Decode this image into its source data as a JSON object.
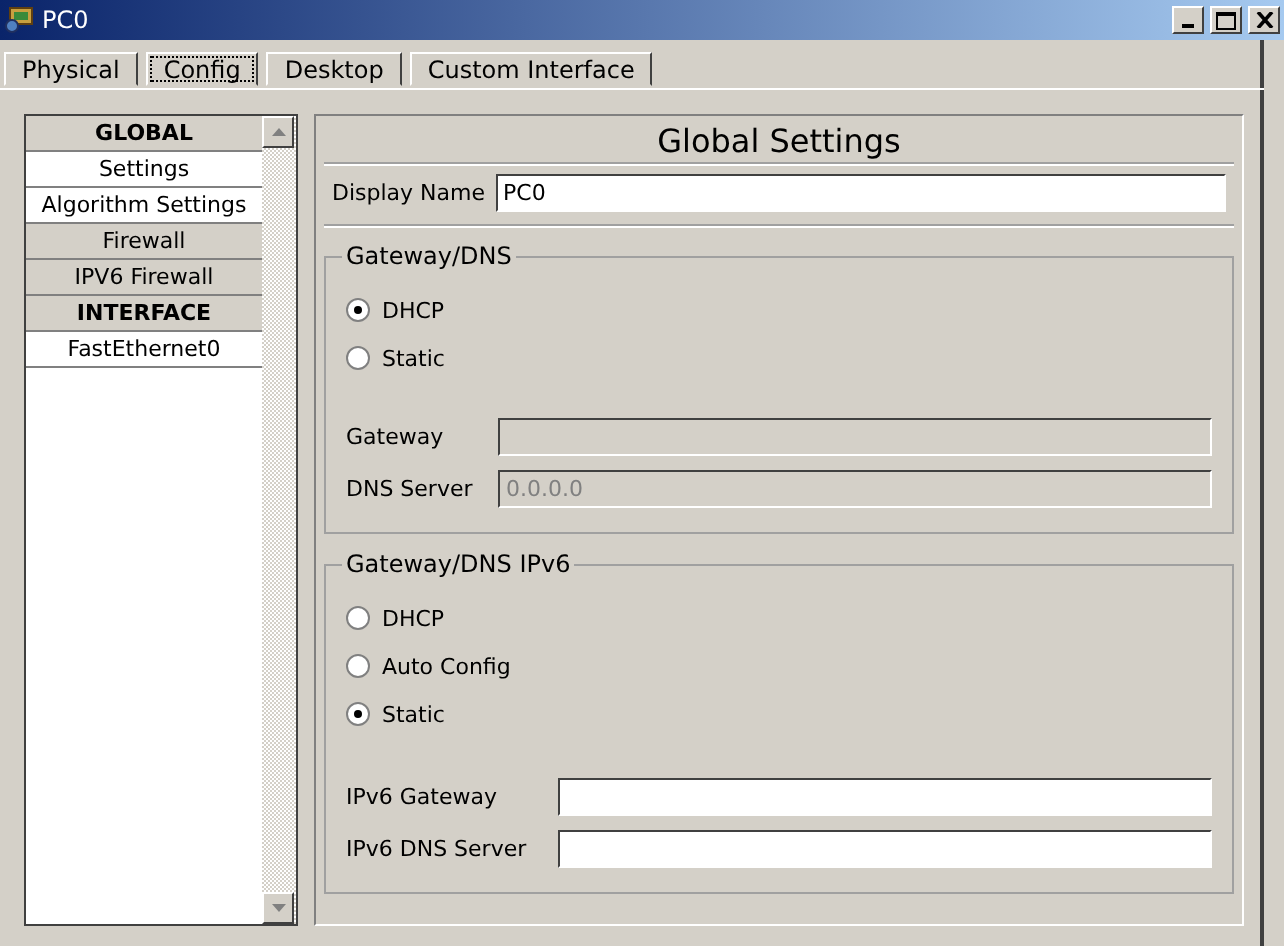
{
  "window": {
    "title": "PC0"
  },
  "tabs": [
    {
      "label": "Physical",
      "selected": false
    },
    {
      "label": "Config",
      "selected": true
    },
    {
      "label": "Desktop",
      "selected": false
    },
    {
      "label": "Custom Interface",
      "selected": false
    }
  ],
  "sidebar": {
    "items": [
      {
        "label": "GLOBAL",
        "kind": "header"
      },
      {
        "label": "Settings",
        "kind": "item"
      },
      {
        "label": "Algorithm Settings",
        "kind": "item"
      },
      {
        "label": "Firewall",
        "kind": "button"
      },
      {
        "label": "IPV6 Firewall",
        "kind": "button"
      },
      {
        "label": "INTERFACE",
        "kind": "header"
      },
      {
        "label": "FastEthernet0",
        "kind": "item"
      }
    ]
  },
  "panel": {
    "title": "Global Settings",
    "display_name": {
      "label": "Display Name",
      "value": "PC0"
    },
    "groups": [
      {
        "title": "Gateway/DNS",
        "options": [
          {
            "label": "DHCP",
            "selected": true
          },
          {
            "label": "Static",
            "selected": false
          }
        ],
        "fields": [
          {
            "label": "Gateway",
            "disabled": true
          },
          {
            "label": "DNS Server",
            "value": "0.0.0.0",
            "disabled": true
          }
        ]
      },
      {
        "title": "Gateway/DNS IPv6",
        "options": [
          {
            "label": "DHCP",
            "selected": false
          },
          {
            "label": "Auto Config",
            "selected": false
          },
          {
            "label": "Static",
            "selected": true
          }
        ],
        "fields": [
          {
            "label": "IPv6 Gateway",
            "disabled": false
          },
          {
            "label": "IPv6 DNS Server",
            "disabled": false
          }
        ]
      }
    ]
  }
}
